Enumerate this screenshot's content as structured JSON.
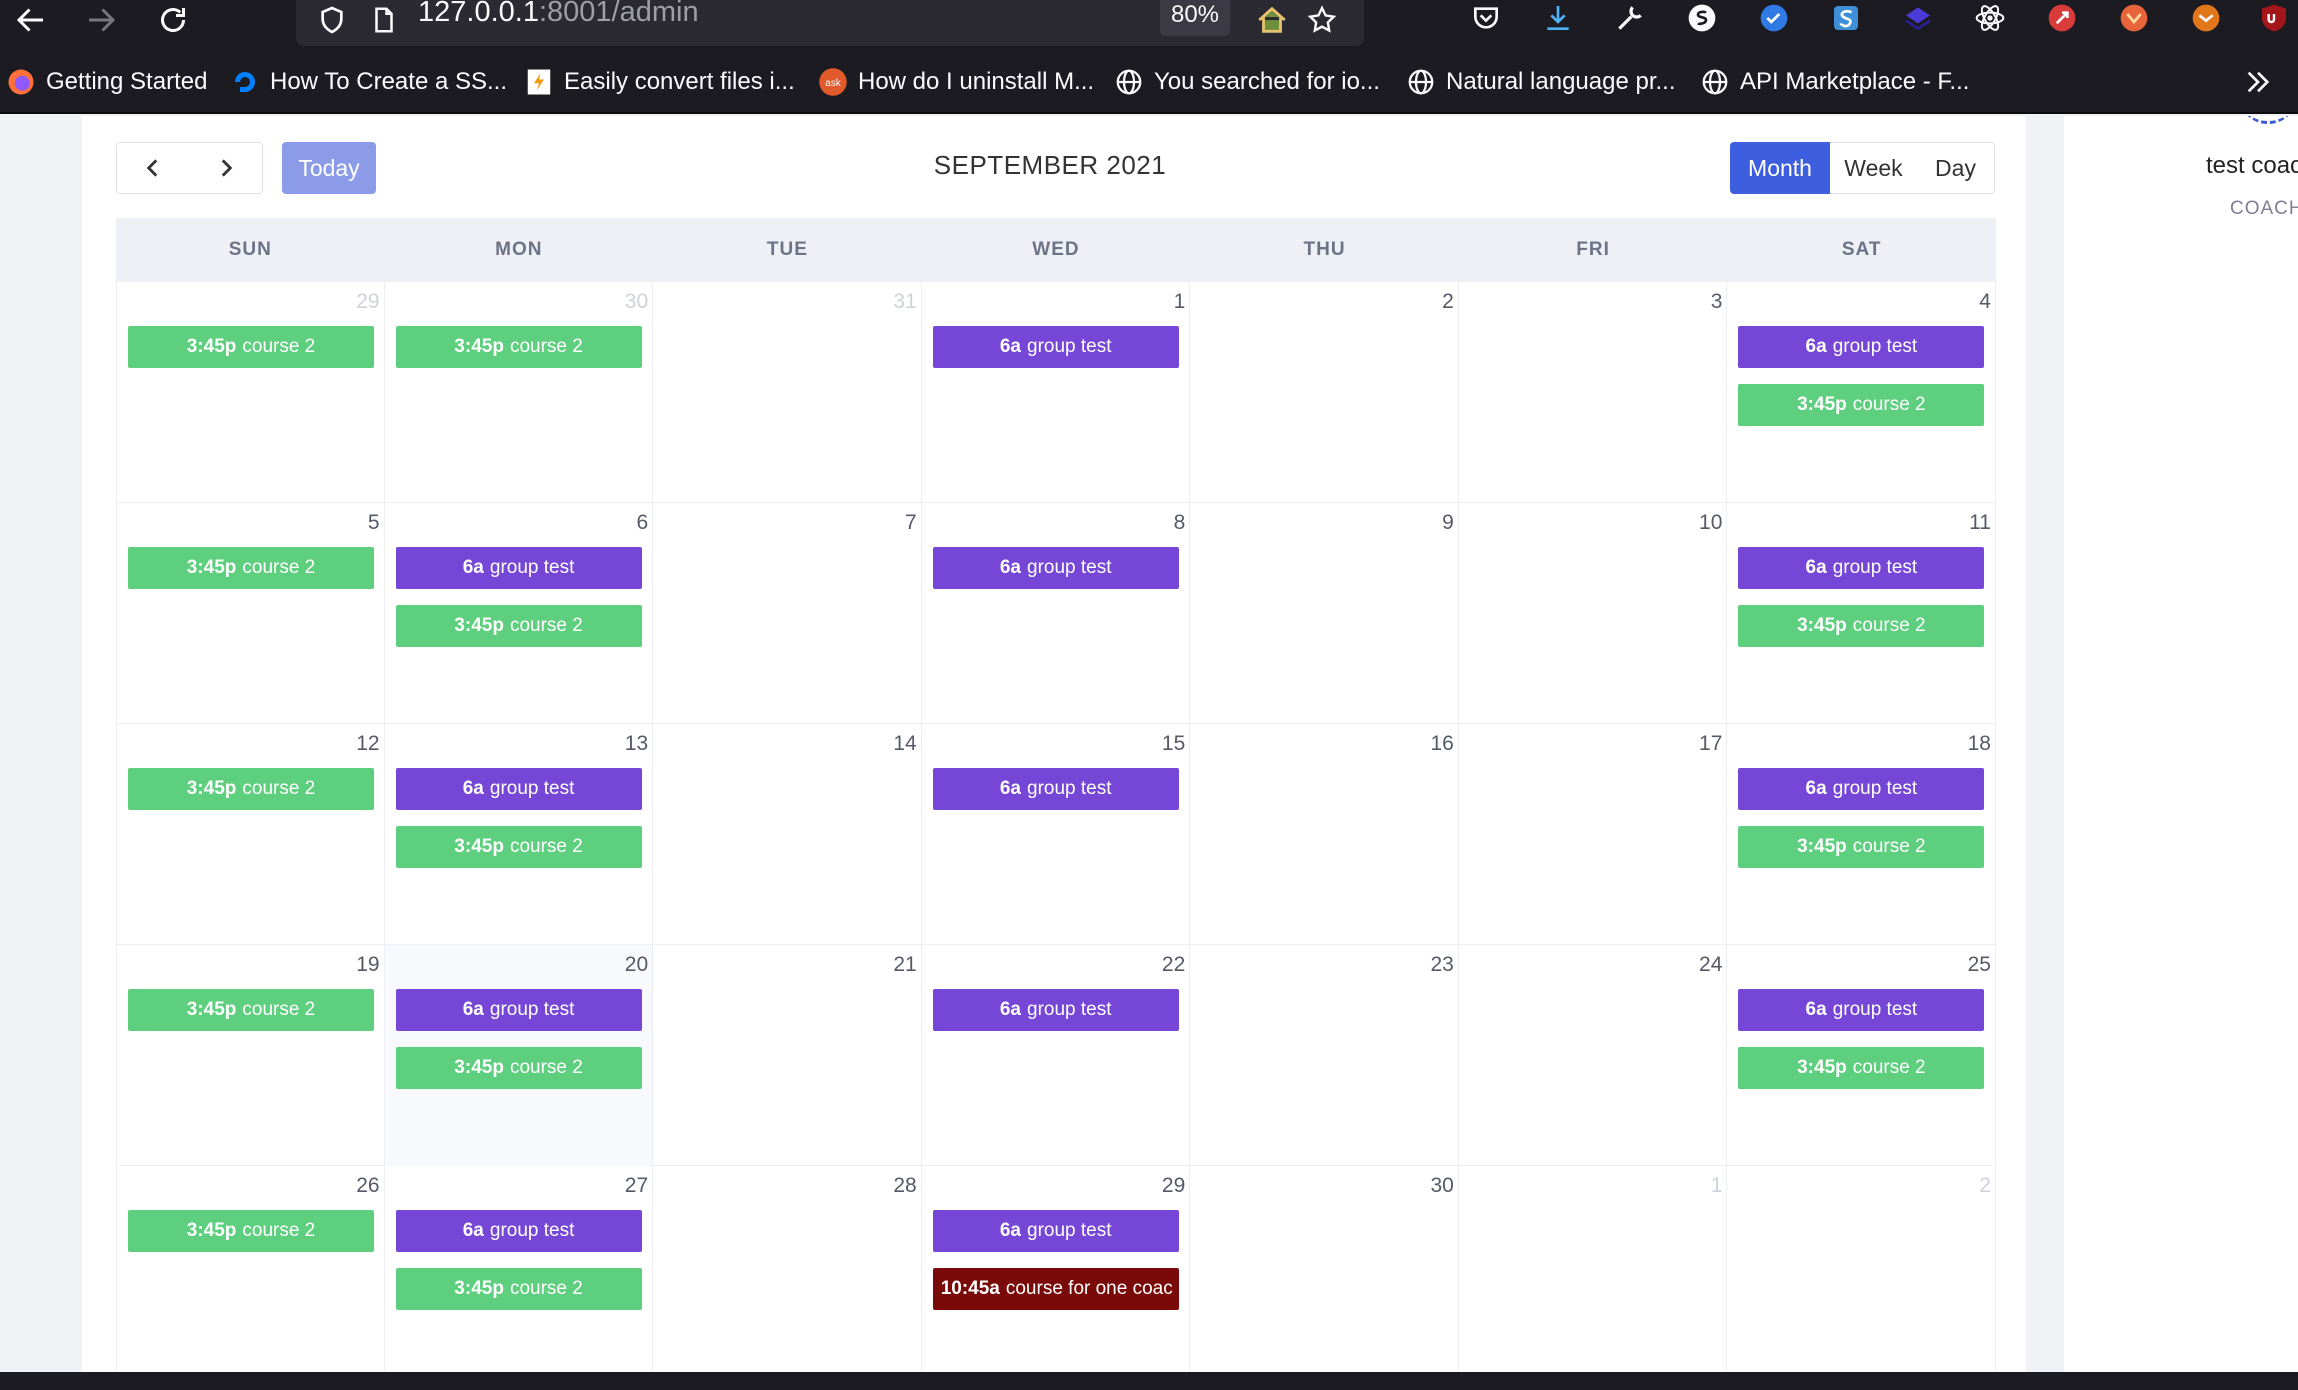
{
  "browser": {
    "url_host": "127.0.0.1",
    "url_rest": ":8001/admin",
    "zoom": "80%",
    "colors": {
      "chrome": "#1c1b22",
      "urlbar": "#2b2a33"
    }
  },
  "bookmarks": [
    {
      "label": "Getting Started",
      "icon": "firefox-icon"
    },
    {
      "label": "How To Create a SS...",
      "icon": "digitalocean-icon"
    },
    {
      "label": "Easily convert files i...",
      "icon": "convert-icon"
    },
    {
      "label": "How do I uninstall M...",
      "icon": "ask-icon"
    },
    {
      "label": "You searched for io...",
      "icon": "globe-icon"
    },
    {
      "label": "Natural language pr...",
      "icon": "globe-icon"
    },
    {
      "label": "API Marketplace - F...",
      "icon": "globe-icon"
    }
  ],
  "calendar": {
    "title": "SEPTEMBER 2021",
    "today_label": "Today",
    "views": {
      "month": "Month",
      "week": "Week",
      "day": "Day"
    },
    "dow": [
      "SUN",
      "MON",
      "TUE",
      "WED",
      "THU",
      "FRI",
      "SAT"
    ],
    "colors": {
      "course": "#5ecf7f",
      "group": "#7646d6",
      "single": "#7a0a0a",
      "primary": "#3e5ee0"
    },
    "weeks": [
      [
        {
          "date": "29",
          "other": true,
          "events": [
            {
              "time": "3:45p",
              "title": "course 2",
              "color": "green"
            }
          ]
        },
        {
          "date": "30",
          "other": true,
          "events": [
            {
              "time": "3:45p",
              "title": "course 2",
              "color": "green"
            }
          ]
        },
        {
          "date": "31",
          "other": true,
          "events": []
        },
        {
          "date": "1",
          "events": [
            {
              "time": "6a",
              "title": "group test",
              "color": "purple"
            }
          ]
        },
        {
          "date": "2",
          "events": []
        },
        {
          "date": "3",
          "events": []
        },
        {
          "date": "4",
          "events": [
            {
              "time": "6a",
              "title": "group test",
              "color": "purple"
            },
            {
              "time": "3:45p",
              "title": "course 2",
              "color": "green"
            }
          ]
        }
      ],
      [
        {
          "date": "5",
          "events": [
            {
              "time": "3:45p",
              "title": "course 2",
              "color": "green"
            }
          ]
        },
        {
          "date": "6",
          "events": [
            {
              "time": "6a",
              "title": "group test",
              "color": "purple"
            },
            {
              "time": "3:45p",
              "title": "course 2",
              "color": "green"
            }
          ]
        },
        {
          "date": "7",
          "events": []
        },
        {
          "date": "8",
          "events": [
            {
              "time": "6a",
              "title": "group test",
              "color": "purple"
            }
          ]
        },
        {
          "date": "9",
          "events": []
        },
        {
          "date": "10",
          "events": []
        },
        {
          "date": "11",
          "events": [
            {
              "time": "6a",
              "title": "group test",
              "color": "purple"
            },
            {
              "time": "3:45p",
              "title": "course 2",
              "color": "green"
            }
          ]
        }
      ],
      [
        {
          "date": "12",
          "events": [
            {
              "time": "3:45p",
              "title": "course 2",
              "color": "green"
            }
          ]
        },
        {
          "date": "13",
          "events": [
            {
              "time": "6a",
              "title": "group test",
              "color": "purple"
            },
            {
              "time": "3:45p",
              "title": "course 2",
              "color": "green"
            }
          ]
        },
        {
          "date": "14",
          "events": []
        },
        {
          "date": "15",
          "events": [
            {
              "time": "6a",
              "title": "group test",
              "color": "purple"
            }
          ]
        },
        {
          "date": "16",
          "events": []
        },
        {
          "date": "17",
          "events": []
        },
        {
          "date": "18",
          "events": [
            {
              "time": "6a",
              "title": "group test",
              "color": "purple"
            },
            {
              "time": "3:45p",
              "title": "course 2",
              "color": "green"
            }
          ]
        }
      ],
      [
        {
          "date": "19",
          "events": [
            {
              "time": "3:45p",
              "title": "course 2",
              "color": "green"
            }
          ]
        },
        {
          "date": "20",
          "today": true,
          "events": [
            {
              "time": "6a",
              "title": "group test",
              "color": "purple"
            },
            {
              "time": "3:45p",
              "title": "course 2",
              "color": "green"
            }
          ]
        },
        {
          "date": "21",
          "events": []
        },
        {
          "date": "22",
          "events": [
            {
              "time": "6a",
              "title": "group test",
              "color": "purple"
            }
          ]
        },
        {
          "date": "23",
          "events": []
        },
        {
          "date": "24",
          "events": []
        },
        {
          "date": "25",
          "events": [
            {
              "time": "6a",
              "title": "group test",
              "color": "purple"
            },
            {
              "time": "3:45p",
              "title": "course 2",
              "color": "green"
            }
          ]
        }
      ],
      [
        {
          "date": "26",
          "events": [
            {
              "time": "3:45p",
              "title": "course 2",
              "color": "green"
            }
          ]
        },
        {
          "date": "27",
          "events": [
            {
              "time": "6a",
              "title": "group test",
              "color": "purple"
            },
            {
              "time": "3:45p",
              "title": "course 2",
              "color": "green"
            }
          ]
        },
        {
          "date": "28",
          "events": []
        },
        {
          "date": "29",
          "events": [
            {
              "time": "6a",
              "title": "group test",
              "color": "purple"
            },
            {
              "time": "10:45a",
              "title": "course for one coac",
              "color": "red"
            }
          ]
        },
        {
          "date": "30",
          "events": []
        },
        {
          "date": "1",
          "other": true,
          "events": []
        },
        {
          "date": "2",
          "other": true,
          "events": []
        }
      ]
    ]
  },
  "sidebar": {
    "name": "test coac",
    "role": "COACH"
  }
}
